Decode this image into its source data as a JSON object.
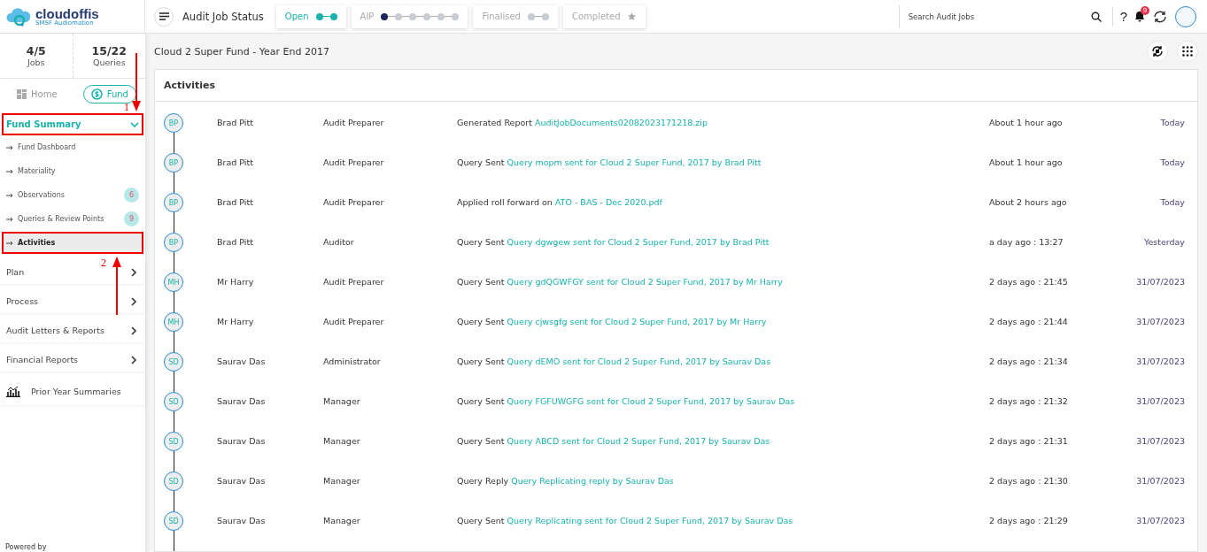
{
  "logo": {
    "name": "cloudoffis",
    "tagline": "SMSF Audiomation"
  },
  "status_bar": {
    "title": "Audit Job Status",
    "stages": [
      {
        "label": "Open",
        "selected": true,
        "kind": "dots",
        "steps": [
          {
            "done": true,
            "current": false
          },
          {
            "done": true,
            "current": false
          }
        ]
      },
      {
        "label": "AIP",
        "selected": false,
        "kind": "dots",
        "steps": [
          {
            "done": false,
            "current": true
          },
          {
            "done": false,
            "current": false
          },
          {
            "done": false,
            "current": false
          },
          {
            "done": false,
            "current": false
          },
          {
            "done": false,
            "current": false
          },
          {
            "done": false,
            "current": false
          }
        ]
      },
      {
        "label": "Finalised",
        "selected": false,
        "kind": "dots",
        "steps": [
          {
            "done": false,
            "current": false
          },
          {
            "done": false,
            "current": false
          }
        ]
      },
      {
        "label": "Completed",
        "selected": false,
        "kind": "star"
      }
    ]
  },
  "search": {
    "placeholder": "Search Audit Jobs"
  },
  "help": "?",
  "notifications": {
    "count": "9"
  },
  "sidebar": {
    "stats": [
      {
        "value": "4/5",
        "label": "Jobs"
      },
      {
        "value": "15/22",
        "label": "Queries"
      }
    ],
    "toggle": [
      {
        "label": "Home",
        "selected": false
      },
      {
        "label": "Fund",
        "selected": true
      }
    ],
    "section": {
      "label": "Fund Summary",
      "expanded": true,
      "annotation": "1",
      "items": [
        {
          "label": "Fund Dashboard",
          "selected": false
        },
        {
          "label": "Materiality",
          "selected": false
        },
        {
          "label": "Observations",
          "selected": false,
          "badge": "6"
        },
        {
          "label": "Queries & Review Points",
          "selected": false,
          "badge": "9"
        },
        {
          "label": "Activities",
          "selected": true,
          "annotation": "2"
        }
      ]
    },
    "groups": [
      {
        "label": "Plan",
        "kind": "group"
      },
      {
        "label": "Process",
        "kind": "group"
      },
      {
        "label": "Audit Letters & Reports",
        "kind": "group"
      },
      {
        "label": "Financial Reports",
        "kind": "group"
      },
      {
        "label": "Prior Year Summaries",
        "kind": "link"
      }
    ],
    "footer": "Powered by"
  },
  "page_title": "Cloud 2 Super Fund - Year End 2017",
  "activities": {
    "title": "Activities",
    "rows": [
      {
        "initials": "BP",
        "name": "Brad Pitt",
        "role": "Audit Preparer",
        "action": "Generated Report",
        "link": "AuditJobDocuments02082023171218.zip",
        "time": "About 1 hour ago",
        "day": "Today"
      },
      {
        "initials": "BP",
        "name": "Brad Pitt",
        "role": "Audit Preparer",
        "action": "Query Sent",
        "link": "Query mopm sent for Cloud 2 Super Fund, 2017 by Brad Pitt",
        "time": "About 1 hour ago",
        "day": "Today"
      },
      {
        "initials": "BP",
        "name": "Brad Pitt",
        "role": "Audit Preparer",
        "action": "Applied roll forward on",
        "link": "ATO - BAS - Dec 2020.pdf",
        "time": "About 2 hours ago",
        "day": "Today"
      },
      {
        "initials": "BP",
        "name": "Brad Pitt",
        "role": "Auditor",
        "action": "Query Sent",
        "link": "Query dgwgew sent for Cloud 2 Super Fund, 2017 by Brad Pitt",
        "time": "a day ago : 13:27",
        "day": "Yesterday"
      },
      {
        "initials": "MH",
        "name": "Mr Harry",
        "role": "Audit Preparer",
        "action": "Query Sent",
        "link": "Query gdQGWFGY sent for Cloud 2 Super Fund, 2017 by Mr Harry",
        "time": "2 days ago : 21:45",
        "day": "31/07/2023"
      },
      {
        "initials": "MH",
        "name": "Mr Harry",
        "role": "Audit Preparer",
        "action": "Query Sent",
        "link": "Query cjwsgfg sent for Cloud 2 Super Fund, 2017 by Mr Harry",
        "time": "2 days ago : 21:44",
        "day": "31/07/2023"
      },
      {
        "initials": "SD",
        "name": "Saurav Das",
        "role": "Administrator",
        "action": "Query Sent",
        "link": "Query dEMO sent for Cloud 2 Super Fund, 2017 by Saurav Das",
        "time": "2 days ago : 21:34",
        "day": "31/07/2023"
      },
      {
        "initials": "SD",
        "name": "Saurav Das",
        "role": "Manager",
        "action": "Query Sent",
        "link": "Query FGFUWGFG sent for Cloud 2 Super Fund, 2017 by Saurav Das",
        "time": "2 days ago : 21:32",
        "day": "31/07/2023"
      },
      {
        "initials": "SD",
        "name": "Saurav Das",
        "role": "Manager",
        "action": "Query Sent",
        "link": "Query ABCD sent for Cloud 2 Super Fund, 2017 by Saurav Das",
        "time": "2 days ago : 21:31",
        "day": "31/07/2023"
      },
      {
        "initials": "SD",
        "name": "Saurav Das",
        "role": "Manager",
        "action": "Query Reply",
        "link": "Query Replicating reply by Saurav Das",
        "time": "2 days ago : 21:30",
        "day": "31/07/2023"
      },
      {
        "initials": "SD",
        "name": "Saurav Das",
        "role": "Manager",
        "action": "Query Sent",
        "link": "Query Replicating sent for Cloud 2 Super Fund, 2017 by Saurav Das",
        "time": "2 days ago : 21:29",
        "day": "31/07/2023"
      }
    ]
  }
}
